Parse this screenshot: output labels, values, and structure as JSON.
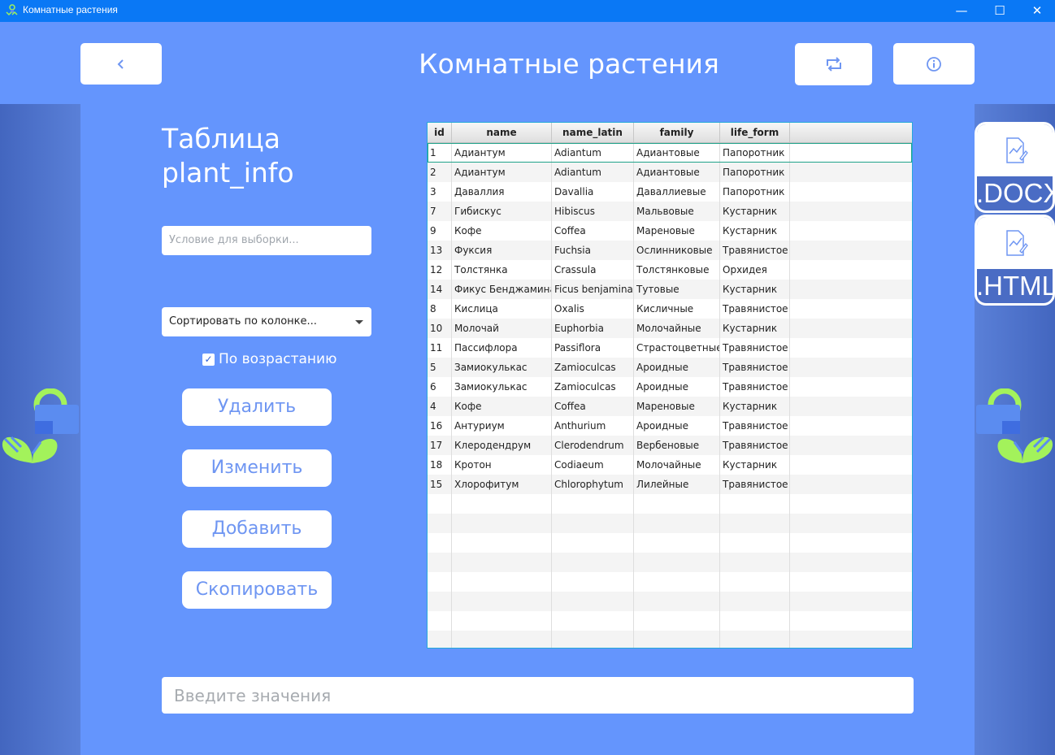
{
  "window": {
    "title": "Комнатные растения",
    "minimize": "—",
    "maximize": "☐",
    "close": "✕"
  },
  "header": {
    "title": "Комнатные растения",
    "back_icon": "chevron-left-icon",
    "refresh_icon": "refresh-icon",
    "info_icon": "info-icon"
  },
  "sidebar": {
    "table_title": "Таблица\nplant_info",
    "filter_placeholder": "Условие для выборки...",
    "sort_label": "Сортировать по колонке...",
    "ascending_label": "По возрастанию",
    "ascending_checked": true,
    "buttons": {
      "delete": "Удалить",
      "edit": "Изменить",
      "add": "Добавить",
      "copy": "Скопировать"
    }
  },
  "input": {
    "placeholder": "Введите значения"
  },
  "table": {
    "columns": [
      "id",
      "name",
      "name_latin",
      "family",
      "life_form"
    ],
    "rows": [
      [
        "1",
        "Адиантум",
        "Adiantum",
        "Адиантовые",
        "Папоротник"
      ],
      [
        "2",
        "Адиантум",
        "Adiantum",
        "Адиантовые",
        "Папоротник"
      ],
      [
        "3",
        "Даваллия",
        "Davallia",
        "Даваллиевые",
        "Папоротник"
      ],
      [
        "7",
        "Гибискус",
        "Hibiscus",
        "Мальвовые",
        "Кустарник"
      ],
      [
        "9",
        "Кофе",
        "Coffea",
        "Мареновые",
        "Кустарник"
      ],
      [
        "13",
        "Фуксия",
        "Fuchsia",
        "Ослинниковые",
        "Травянистое"
      ],
      [
        "12",
        "Толстянка",
        "Crassula",
        "Толстянковые",
        "Орхидея"
      ],
      [
        "14",
        "Фикус Бенджамина",
        "Ficus benjamina",
        "Тутовые",
        "Кустарник"
      ],
      [
        "8",
        "Кислица",
        "Oxalis",
        "Кисличные",
        "Травянистое"
      ],
      [
        "10",
        "Молочай",
        "Euphorbia",
        "Молочайные",
        "Кустарник"
      ],
      [
        "11",
        "Пассифлора",
        "Passiflora",
        "Страстоцветные",
        "Травянистое"
      ],
      [
        "5",
        "Замиокулькас",
        "Zamioculcas",
        "Ароидные",
        "Травянистое"
      ],
      [
        "6",
        "Замиокулькас",
        "Zamioculcas",
        "Ароидные",
        "Травянистое"
      ],
      [
        "4",
        "Кофе",
        "Coffea",
        "Мареновые",
        "Кустарник"
      ],
      [
        "16",
        "Антуриум",
        "Anthurium",
        "Ароидные",
        "Травянистое"
      ],
      [
        "17",
        "Клеродендрум",
        "Clerodendrum",
        "Вербеновые",
        "Травянистое"
      ],
      [
        "18",
        "Кротон",
        "Codiaeum",
        "Молочайные",
        "Кустарник"
      ],
      [
        "15",
        "Хлорофитум",
        "Chlorophytum",
        "Лилейные",
        "Травянистое"
      ]
    ],
    "empty_rows": 8
  },
  "export": {
    "docx_label": ".DOCX",
    "html_label": ".HTML",
    "icon": "document-chart-icon"
  },
  "colors": {
    "titlebar": "#0a78f5",
    "header": "#6495fd",
    "side": "#4e70c7",
    "accent": "#6f96f2",
    "plant_green": "#a3f25b"
  }
}
